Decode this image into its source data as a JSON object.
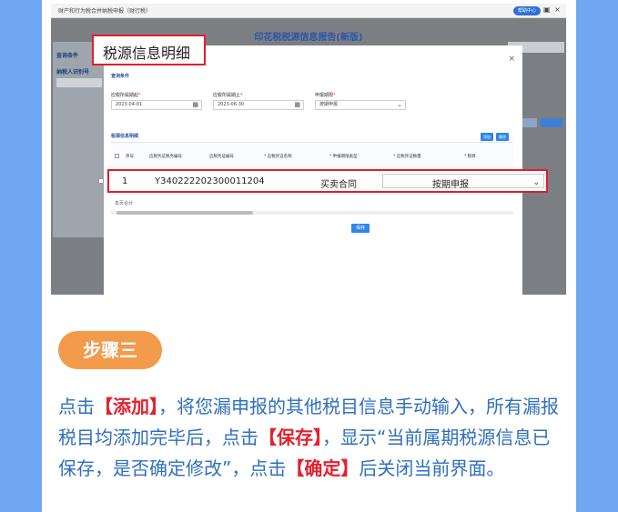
{
  "screenshot": {
    "breadcrumb": "财产和行为税合并纳税申报（财行税）",
    "help_pill": "帮助中心",
    "page_title": "印花税税源信息报告(新版)",
    "side_query_label": "查询条件",
    "side_taxpayer_label": "纳税人识别号"
  },
  "modal": {
    "title": "税源信息明细",
    "close": "×",
    "query_section": "查询条件",
    "period_start_label": "应税所属期起",
    "period_start_value": "2023-04-01",
    "period_end_label": "应税所属期止",
    "period_end_value": "2023-06-30",
    "report_mode_label": "申报期限",
    "report_mode_value": "按期申报",
    "detail_section": "税源信息明细",
    "add_button": "添加",
    "delete_button": "删除",
    "columns": [
      "序号",
      "应税凭证税务编号",
      "应税凭证编号",
      "* 应税凭证名称",
      "* 申报期限类型",
      "* 应税凭证数量",
      "* 税目"
    ],
    "row": {
      "index": "1",
      "voucher_tax_no": "Y340222202300011204",
      "tax_item": "买卖合同",
      "period_type": "按期申报"
    },
    "total_label": "本页合计",
    "save_button": "保存"
  },
  "step_label": "步骤三",
  "instruction": {
    "p1": "点击",
    "b1": "【添加】",
    "p2": "，将您漏申报的其他税目信息手动输入，所有漏报税目均添加完毕后，点击",
    "b2": "【保存】",
    "p3": "，显示“当前属期税源信息已保存，是否确定修改”，点击",
    "b3": "【确定】",
    "p4": "后关闭当前界面。"
  },
  "colors": {
    "background": "#6fa7f2",
    "highlight": "#e11d2b",
    "step_badge": "#f39a4b",
    "text_blue": "#2f6fbf",
    "primary_button": "#2f86e8"
  }
}
